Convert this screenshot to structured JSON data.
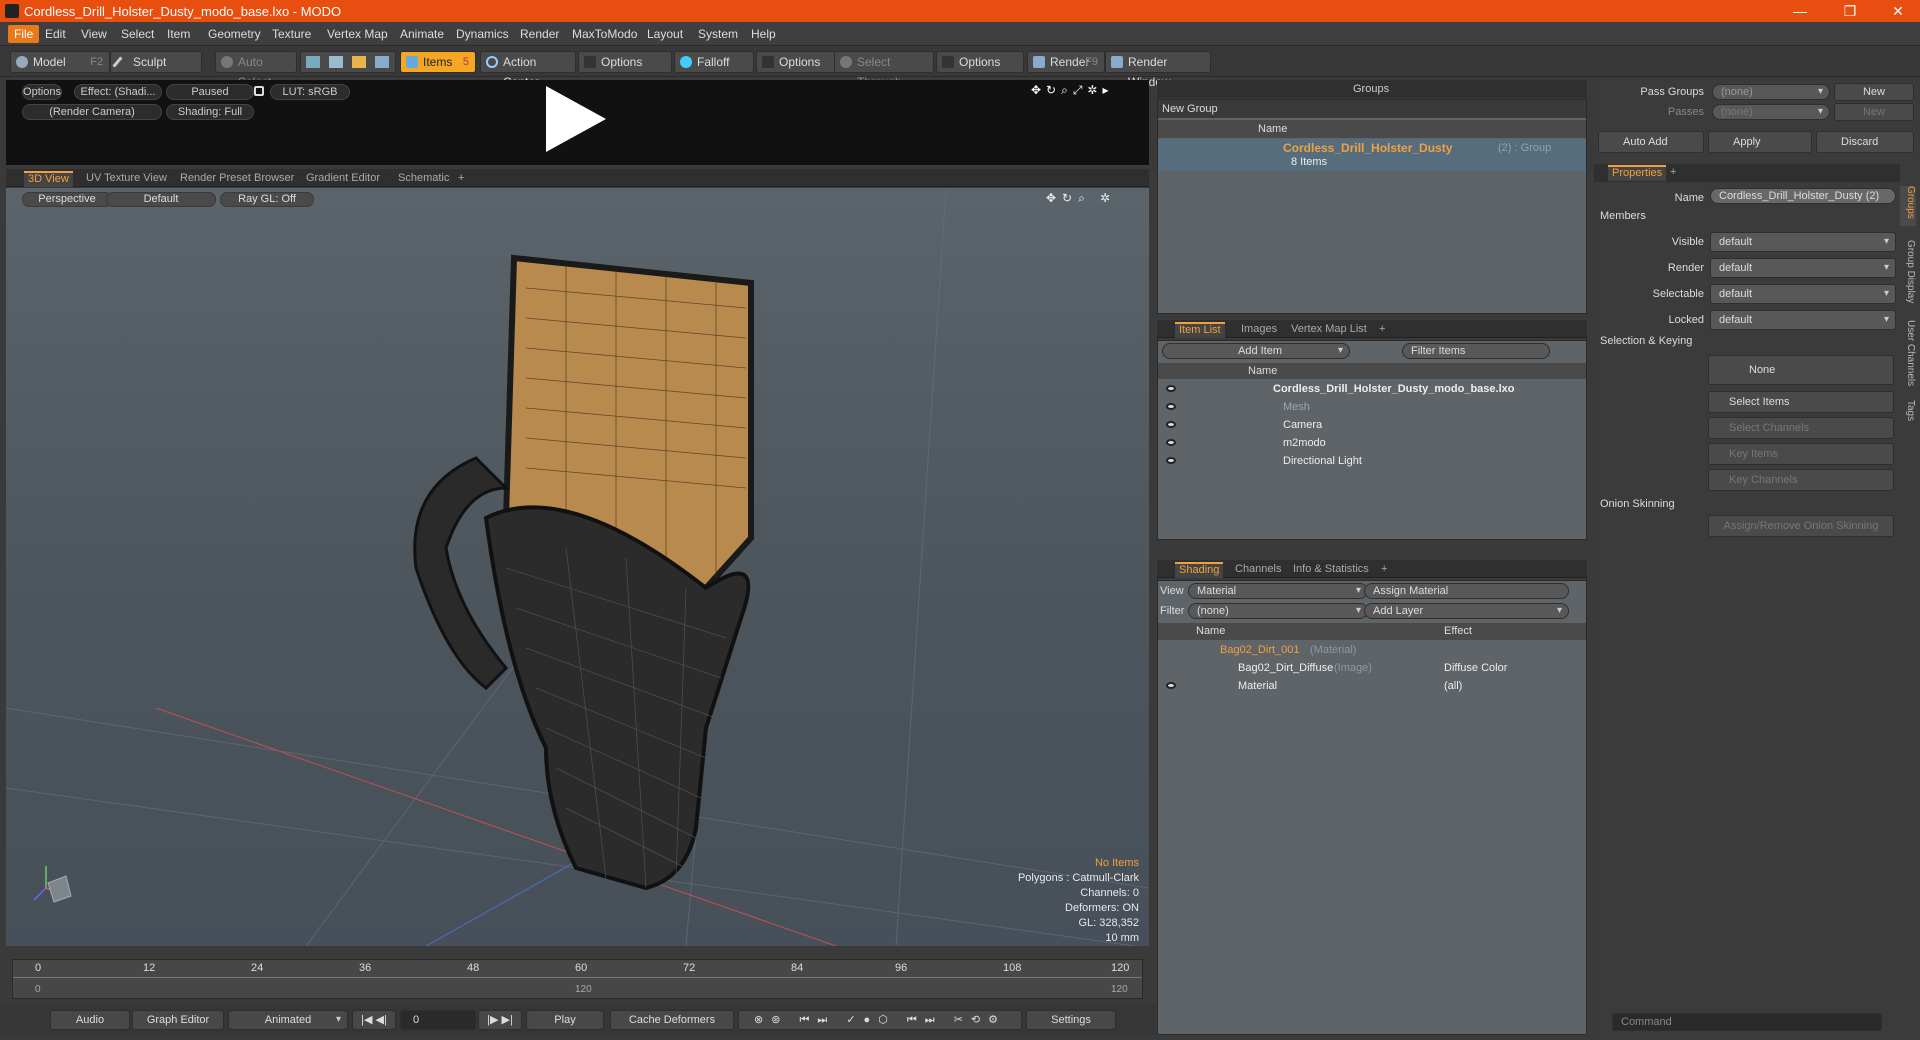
{
  "window": {
    "title": "Cordless_Drill_Holster_Dusty_modo_base.lxo - MODO",
    "minimize": "—",
    "maximize": "❐",
    "close": "✕"
  },
  "menus": [
    "File",
    "Edit",
    "View",
    "Select",
    "Item",
    "Geometry",
    "Texture",
    "Vertex Map",
    "Animate",
    "Dynamics",
    "Render",
    "MaxToModo",
    "Layout",
    "System",
    "Help"
  ],
  "toolbar": {
    "model": "Model",
    "model_key": "F2",
    "sculpt": "Sculpt",
    "auto_select": "Auto Select",
    "items": "Items",
    "items_key": "5",
    "action_center": "Action Center",
    "options1": "Options",
    "falloff": "Falloff",
    "options2": "Options",
    "select_through": "Select Through",
    "options3": "Options",
    "render": "Render",
    "render_key": "F9",
    "render_window": "Render Window"
  },
  "preview": {
    "options": "Options",
    "effect": "Effect: (Shadi...",
    "paused": "Paused",
    "lut": "LUT: sRGB",
    "camera": "(Render Camera)",
    "shading": "Shading: Full"
  },
  "viewport_tabs": [
    "3D View",
    "UV Texture View",
    "Render Preset Browser",
    "Gradient Editor",
    "Schematic",
    "+"
  ],
  "viewport": {
    "perspective": "Perspective",
    "default": "Default",
    "raygl": "Ray GL: Off",
    "no_items": "No Items",
    "polygons": "Polygons : Catmull-Clark",
    "channels": "Channels: 0",
    "deformers": "Deformers: ON",
    "gl": "GL: 328,352",
    "scale": "10 mm"
  },
  "timeline": {
    "ticks": [
      "0",
      "12",
      "24",
      "36",
      "48",
      "60",
      "72",
      "84",
      "96",
      "108",
      "120"
    ],
    "start": "0",
    "mid": "120",
    "end": "120"
  },
  "bottombar": {
    "audio": "Audio",
    "graph_editor": "Graph Editor",
    "animated": "Animated",
    "frame": "0",
    "play": "Play",
    "cache_deformers": "Cache Deformers",
    "settings": "Settings"
  },
  "groups": {
    "title": "Groups",
    "new_group": "New Group",
    "name_col": "Name",
    "item_name": "Cordless_Drill_Holster_Dusty",
    "item_suffix": "(2) : Group",
    "item_count": "8 Items"
  },
  "itemlist": {
    "tabs": [
      "Item List",
      "Images",
      "Vertex Map List",
      "+"
    ],
    "add_item": "Add Item",
    "filter": "Filter Items",
    "name_col": "Name",
    "items": [
      {
        "label": "Cordless_Drill_Holster_Dusty_modo_base.lxo"
      },
      {
        "label": "Mesh"
      },
      {
        "label": "Camera"
      },
      {
        "label": "m2modo"
      },
      {
        "label": "Directional Light"
      }
    ]
  },
  "shading": {
    "tabs": [
      "Shading",
      "Channels",
      "Info & Statistics",
      "+"
    ],
    "view_label": "View",
    "view_value": "Material",
    "assign_material": "Assign Material",
    "filter_label": "Filter",
    "filter_value": "(none)",
    "add_layer": "Add Layer",
    "name_col": "Name",
    "effect_col": "Effect",
    "rows": [
      {
        "name": "Bag02_Dirt_001",
        "type": "(Material)",
        "effect": ""
      },
      {
        "name": "Bag02_Dirt_Diffuse",
        "type": "(Image)",
        "effect": "Diffuse Color"
      },
      {
        "name": "Material",
        "type": "",
        "effect": "(all)"
      }
    ]
  },
  "props": {
    "pass_groups": "Pass Groups",
    "passes": "Passes",
    "none": "(none)",
    "none2": "(none)",
    "new": "New",
    "new2": "New",
    "auto_add": "Auto Add",
    "apply": "Apply",
    "discard": "Discard",
    "tab": "Properties",
    "tab_plus": "+",
    "name_label": "Name",
    "name_value": "Cordless_Drill_Holster_Dusty (2)",
    "members": "Members",
    "fields": [
      {
        "label": "Visible",
        "value": "default"
      },
      {
        "label": "Render",
        "value": "default"
      },
      {
        "label": "Selectable",
        "value": "default"
      },
      {
        "label": "Locked",
        "value": "default"
      }
    ],
    "selection_keying": "Selection & Keying",
    "none_btn": "None",
    "select_items": "Select Items",
    "select_channels": "Select Channels",
    "key_items": "Key Items",
    "key_channels": "Key Channels",
    "onion": "Onion Skinning",
    "assign_onion": "Assign/Remove Onion Skinning",
    "vtabs": [
      "Groups",
      "Group Display",
      "User Channels",
      "Tags"
    ],
    "command": "Command"
  }
}
